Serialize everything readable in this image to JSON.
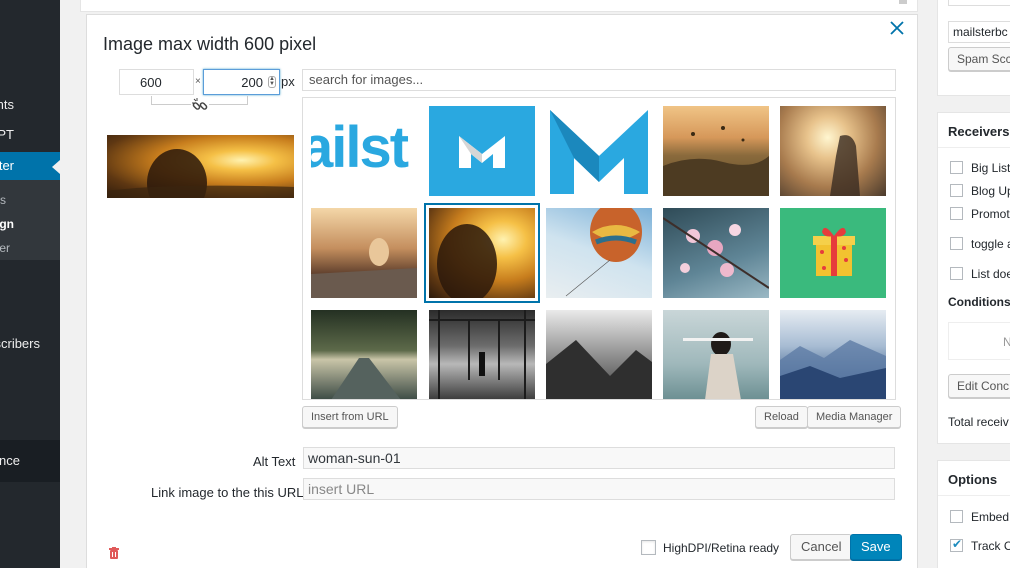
{
  "wp_menu": {
    "items": [
      "nts",
      "PT",
      "ter",
      "s",
      "gn",
      "er",
      "scribers",
      "nce"
    ]
  },
  "modal": {
    "title": "Image max width 600 pixel",
    "close_icon": "close-icon",
    "width_value": "600",
    "height_value": "200",
    "times": "×",
    "unit": "px",
    "search_placeholder": "search for images...",
    "buttons": {
      "insert_url": "Insert from URL",
      "reload": "Reload",
      "media_manager": "Media Manager",
      "cancel": "Cancel",
      "save": "Save"
    },
    "alt_label": "Alt Text",
    "alt_value": "woman-sun-01",
    "link_label": "Link image to the this URL",
    "link_placeholder": "insert URL",
    "hdpi_label": "HighDPI/Retina ready",
    "hdpi_checked": false,
    "logo_text": "ailst"
  },
  "right_column": {
    "list_input": "mailsterbc",
    "spam_button": "Spam Scc",
    "receivers_title": "Receivers",
    "receivers_items": [
      "Big List",
      "Blog Up",
      "Promot",
      "toggle a",
      "List doe"
    ],
    "conditions_title": "Conditions",
    "conditions_value": "N",
    "edit_conditions": "Edit Conc",
    "total_receivers": "Total receiv",
    "options_title": "Options",
    "options_items": [
      {
        "label": "Embed",
        "checked": false
      },
      {
        "label": "Track C",
        "checked": true
      }
    ]
  },
  "colors": {
    "accent": "#0073aa",
    "mailster_blue": "#2aa8e0",
    "gift_green": "#3aba7d"
  }
}
